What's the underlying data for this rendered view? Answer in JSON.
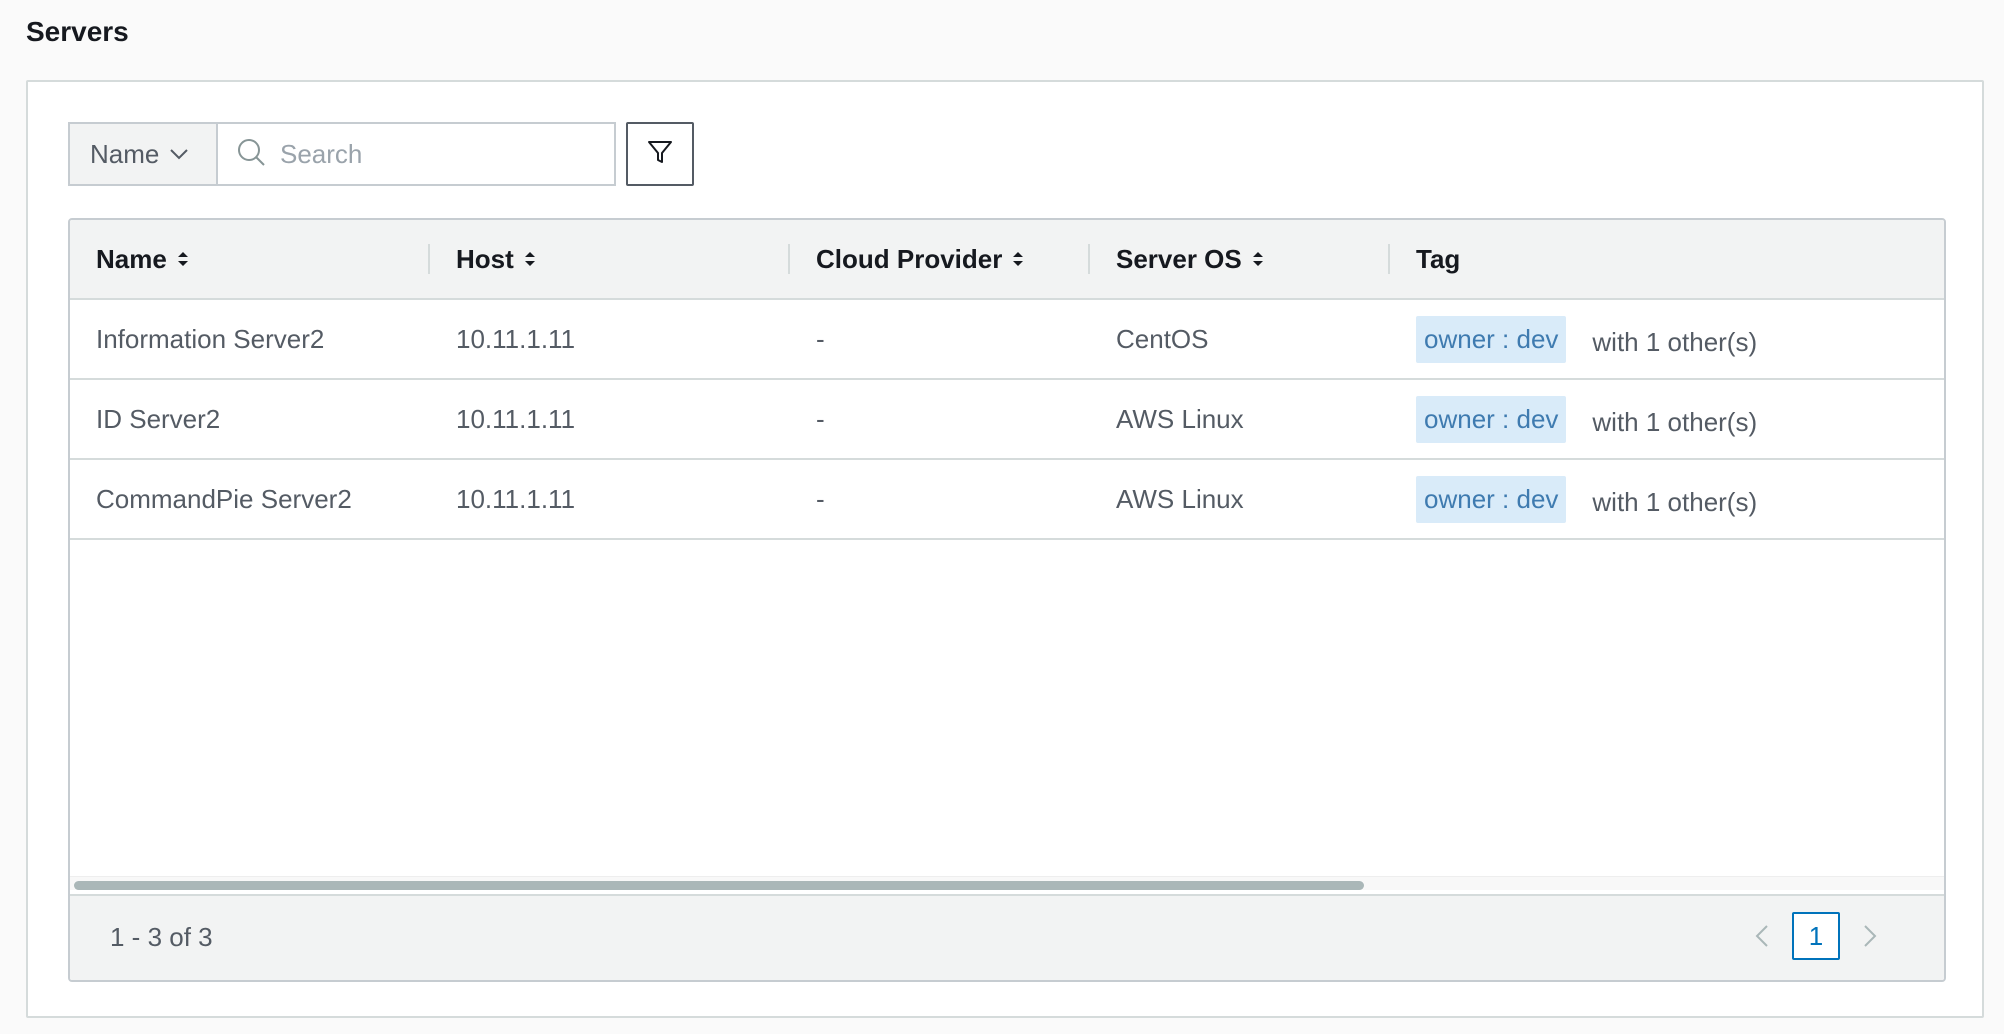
{
  "page": {
    "title": "Servers"
  },
  "toolbar": {
    "field_select_value": "Name",
    "search_placeholder": "Search"
  },
  "table": {
    "columns": [
      {
        "label": "Name",
        "sortable": true
      },
      {
        "label": "Host",
        "sortable": true
      },
      {
        "label": "Cloud Provider",
        "sortable": true
      },
      {
        "label": "Server OS",
        "sortable": true
      },
      {
        "label": "Tag",
        "sortable": false
      }
    ],
    "rows": [
      {
        "name": "Information Server2",
        "host": "10.11.1.11",
        "cloud": "-",
        "os": "CentOS",
        "tag": "owner : dev",
        "tag_more": "with 1 other(s)"
      },
      {
        "name": "ID Server2",
        "host": "10.11.1.11",
        "cloud": "-",
        "os": "AWS Linux",
        "tag": "owner : dev",
        "tag_more": "with 1 other(s)"
      },
      {
        "name": "CommandPie Server2",
        "host": "10.11.1.11",
        "cloud": "-",
        "os": "AWS Linux",
        "tag": "owner : dev",
        "tag_more": "with 1 other(s)"
      }
    ]
  },
  "footer": {
    "range_text": "1 - 3 of 3",
    "current_page": "1"
  },
  "colors": {
    "accent": "#0073bb",
    "tag_bg": "#d9ebf9",
    "tag_text": "#3f7bb0"
  },
  "icons": {
    "field_select": "chevron-down-icon",
    "search": "search-icon",
    "filter": "filter-icon",
    "sort": "sort-icon",
    "prev": "chevron-left-icon",
    "next": "chevron-right-icon"
  }
}
